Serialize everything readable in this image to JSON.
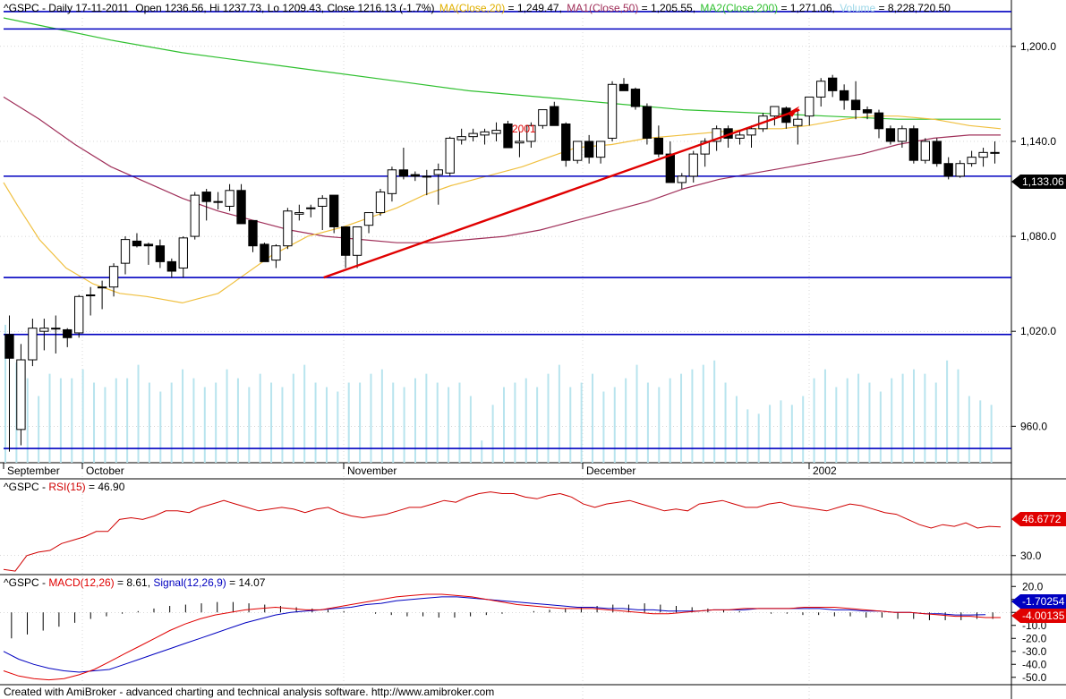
{
  "colors": {
    "background": "#ffffff",
    "up_candle": "#ffffff",
    "down_candle": "#000000",
    "ma20": "#f0c040",
    "ma50": "#a0305a",
    "ma200": "#30c030",
    "volume": "#b8e4ee",
    "hline": "#0000c0",
    "trend": "#e00000",
    "rsi": "#d00000",
    "macd": "#e00000",
    "signal": "#0000c0",
    "grid": "#b0b0b0"
  },
  "header": {
    "symbol": "^GSPC - Daily 17-11-2011",
    "ohlc": "Open 1236.56, Hi 1237.73, Lo 1209.43, Close 1216.13 (-1.7%)",
    "ma_label": "MA(Close,20)",
    "ma_value": " = 1,249.47,",
    "ma1_label": "MA1(Close,50)",
    "ma1_value": " = 1,205.55,",
    "ma2_label": "MA2(Close,200)",
    "ma2_value": " = 1,271.06,",
    "vol_label": "Volume",
    "vol_value": " = 8,228,720.50"
  },
  "price_axis": {
    "ticks": [
      "1,200.0",
      "1,140.0",
      "1,080.0",
      "1,020.0",
      "960.0"
    ],
    "last_value": "1,133.06"
  },
  "x_axis": {
    "labels": [
      "September",
      "October",
      "November",
      "December",
      "2002"
    ]
  },
  "annotations": {
    "year_label": "2001"
  },
  "rsi": {
    "label_sym": "^GSPC - ",
    "label_name": "RSI(15)",
    "label_value": " = 46.90",
    "ticks": [
      "30.0"
    ],
    "last_value": "46.6772"
  },
  "macd": {
    "label_sym": "^GSPC - ",
    "label_name": "MACD(12,26)",
    "label_value": " = 8.61, ",
    "signal_name": "Signal(12,26,9)",
    "signal_value": " = 14.07",
    "ticks": [
      "20.0",
      "10.0",
      "0.0",
      "-10.0",
      "-20.0",
      "-30.0",
      "-40.0",
      "-50.0"
    ],
    "last_macd": "-4.00135",
    "last_signal": "-1.70254"
  },
  "footer": {
    "text": "Created with AmiBroker - advanced charting and technical analysis software. http://www.amibroker.com"
  },
  "chart_data": {
    "type": "candlestick",
    "title": "^GSPC - Daily 17-11-2011",
    "price_range": [
      937,
      1218
    ],
    "candles": [
      [
        1018,
        1030,
        944,
        1003
      ],
      [
        958,
        1012,
        948,
        1002
      ],
      [
        1002,
        1028,
        998,
        1022
      ],
      [
        1020,
        1028,
        1008,
        1022
      ],
      [
        1022,
        1030,
        1006,
        1022
      ],
      [
        1021,
        1022,
        1010,
        1016
      ],
      [
        1019,
        1043,
        1016,
        1042
      ],
      [
        1043,
        1048,
        1030,
        1043
      ],
      [
        1048,
        1052,
        1034,
        1048
      ],
      [
        1048,
        1063,
        1042,
        1061
      ],
      [
        1063,
        1080,
        1056,
        1078
      ],
      [
        1077,
        1082,
        1073,
        1074
      ],
      [
        1075,
        1076,
        1062,
        1074
      ],
      [
        1074,
        1078,
        1060,
        1064
      ],
      [
        1064,
        1066,
        1054,
        1058
      ],
      [
        1060,
        1080,
        1054,
        1079
      ],
      [
        1080,
        1108,
        1078,
        1106
      ],
      [
        1108,
        1110,
        1090,
        1102
      ],
      [
        1102,
        1108,
        1097,
        1102
      ],
      [
        1099,
        1113,
        1096,
        1109
      ],
      [
        1109,
        1113,
        1092,
        1088
      ],
      [
        1090,
        1088,
        1070,
        1074
      ],
      [
        1075,
        1076,
        1064,
        1064
      ],
      [
        1065,
        1075,
        1060,
        1074
      ],
      [
        1074,
        1098,
        1072,
        1096
      ],
      [
        1094,
        1100,
        1090,
        1095
      ],
      [
        1098,
        1100,
        1092,
        1098
      ],
      [
        1099,
        1106,
        1084,
        1104
      ],
      [
        1106,
        1106,
        1082,
        1086
      ],
      [
        1086,
        1086,
        1060,
        1068
      ],
      [
        1068,
        1086,
        1060,
        1086
      ],
      [
        1087,
        1095,
        1082,
        1095
      ],
      [
        1095,
        1110,
        1093,
        1108
      ],
      [
        1107,
        1124,
        1102,
        1122
      ],
      [
        1122,
        1136,
        1116,
        1118
      ],
      [
        1119,
        1121,
        1115,
        1118
      ],
      [
        1118,
        1122,
        1106,
        1118
      ],
      [
        1119,
        1126,
        1100,
        1122
      ],
      [
        1120,
        1143,
        1118,
        1142
      ],
      [
        1141,
        1148,
        1138,
        1143
      ],
      [
        1143,
        1148,
        1140,
        1145
      ],
      [
        1144,
        1148,
        1138,
        1146
      ],
      [
        1145,
        1152,
        1140,
        1147
      ],
      [
        1151,
        1153,
        1140,
        1136
      ],
      [
        1139,
        1146,
        1130,
        1140
      ],
      [
        1140,
        1152,
        1136,
        1150
      ],
      [
        1150,
        1158,
        1148,
        1160
      ],
      [
        1162,
        1165,
        1150,
        1150
      ],
      [
        1151,
        1152,
        1124,
        1128
      ],
      [
        1128,
        1140,
        1126,
        1140
      ],
      [
        1140,
        1144,
        1126,
        1130
      ],
      [
        1130,
        1140,
        1126,
        1140
      ],
      [
        1142,
        1178,
        1140,
        1176
      ],
      [
        1176,
        1180,
        1172,
        1172
      ],
      [
        1173,
        1174,
        1160,
        1162
      ],
      [
        1162,
        1164,
        1138,
        1142
      ],
      [
        1142,
        1150,
        1130,
        1132
      ],
      [
        1132,
        1140,
        1114,
        1114
      ],
      [
        1114,
        1120,
        1110,
        1118
      ],
      [
        1118,
        1134,
        1114,
        1132
      ],
      [
        1132,
        1142,
        1124,
        1140
      ],
      [
        1140,
        1150,
        1134,
        1148
      ],
      [
        1148,
        1150,
        1136,
        1142
      ],
      [
        1142,
        1146,
        1138,
        1144
      ],
      [
        1144,
        1150,
        1136,
        1148
      ],
      [
        1148,
        1158,
        1146,
        1156
      ],
      [
        1156,
        1162,
        1150,
        1162
      ],
      [
        1161,
        1162,
        1148,
        1152
      ],
      [
        1150,
        1160,
        1138,
        1154
      ],
      [
        1156,
        1168,
        1150,
        1168
      ],
      [
        1168,
        1180,
        1162,
        1178
      ],
      [
        1180,
        1182,
        1168,
        1172
      ],
      [
        1172,
        1176,
        1160,
        1166
      ],
      [
        1166,
        1178,
        1154,
        1160
      ],
      [
        1160,
        1162,
        1154,
        1158
      ],
      [
        1158,
        1160,
        1142,
        1148
      ],
      [
        1148,
        1150,
        1138,
        1140
      ],
      [
        1140,
        1150,
        1136,
        1148
      ],
      [
        1148,
        1150,
        1126,
        1128
      ],
      [
        1128,
        1142,
        1126,
        1140
      ],
      [
        1140,
        1142,
        1124,
        1126
      ],
      [
        1126,
        1130,
        1116,
        1118
      ],
      [
        1118,
        1128,
        1117,
        1126
      ],
      [
        1126,
        1134,
        1124,
        1130
      ],
      [
        1130,
        1136,
        1124,
        1133
      ],
      [
        1133,
        1140,
        1126,
        1133
      ]
    ],
    "ma20": [
      [
        0,
        1114
      ],
      [
        15,
        1100
      ],
      [
        40,
        1078
      ],
      [
        70,
        1060
      ],
      [
        100,
        1050
      ],
      [
        130,
        1044
      ],
      [
        160,
        1042
      ],
      [
        200,
        1038
      ],
      [
        240,
        1044
      ],
      [
        270,
        1056
      ],
      [
        300,
        1068
      ],
      [
        340,
        1080
      ],
      [
        380,
        1086
      ],
      [
        410,
        1092
      ],
      [
        440,
        1098
      ],
      [
        470,
        1106
      ],
      [
        500,
        1112
      ],
      [
        540,
        1118
      ],
      [
        580,
        1124
      ],
      [
        610,
        1130
      ],
      [
        640,
        1136
      ],
      [
        680,
        1138
      ],
      [
        720,
        1142
      ],
      [
        760,
        1144
      ],
      [
        800,
        1146
      ],
      [
        840,
        1148
      ],
      [
        870,
        1148
      ],
      [
        900,
        1150
      ],
      [
        940,
        1154
      ],
      [
        970,
        1156
      ],
      [
        1000,
        1156
      ],
      [
        1040,
        1154
      ],
      [
        1080,
        1150
      ],
      [
        1115,
        1148
      ]
    ],
    "ma50": [
      [
        0,
        1168
      ],
      [
        40,
        1154
      ],
      [
        80,
        1138
      ],
      [
        120,
        1124
      ],
      [
        160,
        1114
      ],
      [
        200,
        1104
      ],
      [
        240,
        1096
      ],
      [
        280,
        1090
      ],
      [
        320,
        1084
      ],
      [
        360,
        1080
      ],
      [
        400,
        1078
      ],
      [
        440,
        1076
      ],
      [
        480,
        1076
      ],
      [
        520,
        1078
      ],
      [
        560,
        1080
      ],
      [
        600,
        1084
      ],
      [
        640,
        1090
      ],
      [
        680,
        1096
      ],
      [
        720,
        1102
      ],
      [
        760,
        1110
      ],
      [
        800,
        1116
      ],
      [
        840,
        1120
      ],
      [
        880,
        1124
      ],
      [
        920,
        1128
      ],
      [
        960,
        1132
      ],
      [
        1000,
        1138
      ],
      [
        1040,
        1142
      ],
      [
        1080,
        1144
      ],
      [
        1115,
        1144
      ]
    ],
    "ma200": [
      [
        0,
        1218
      ],
      [
        60,
        1211
      ],
      [
        120,
        1204
      ],
      [
        200,
        1196
      ],
      [
        280,
        1190
      ],
      [
        360,
        1184
      ],
      [
        440,
        1178
      ],
      [
        520,
        1172
      ],
      [
        600,
        1168
      ],
      [
        680,
        1164
      ],
      [
        760,
        1160
      ],
      [
        840,
        1158
      ],
      [
        920,
        1156
      ],
      [
        1000,
        1154
      ],
      [
        1060,
        1154
      ],
      [
        1115,
        1154
      ]
    ],
    "hlines": [
      1211,
      1222,
      1118,
      1054,
      1018,
      946
    ],
    "trend_line": [
      [
        358,
        1054
      ],
      [
        890,
        1160
      ]
    ],
    "volume": [
      0.62,
      0.45,
      0.38,
      0.3,
      0.4,
      0.38,
      0.38,
      0.42,
      0.36,
      0.34,
      0.38,
      0.38,
      0.44,
      0.36,
      0.32,
      0.36,
      0.42,
      0.38,
      0.34,
      0.36,
      0.42,
      0.38,
      0.34,
      0.4,
      0.36,
      0.34,
      0.4,
      0.44,
      0.36,
      0.34,
      0.32,
      0.36,
      0.36,
      0.4,
      0.42,
      0.36,
      0.34,
      0.38,
      0.4,
      0.36,
      0.34,
      0.36,
      0.3,
      0.1,
      0.26,
      0.34,
      0.36,
      0.38,
      0.34,
      0.4,
      0.44,
      0.34,
      0.36,
      0.4,
      0.32,
      0.34,
      0.38,
      0.44,
      0.36,
      0.34,
      0.38,
      0.4,
      0.42,
      0.44,
      0.46,
      0.36,
      0.3,
      0.24,
      0.22,
      0.26,
      0.28,
      0.26,
      0.3,
      0.38,
      0.42,
      0.34,
      0.38,
      0.4,
      0.36,
      0.32,
      0.38,
      0.4,
      0.42,
      0.4,
      0.36,
      0.46,
      0.42,
      0.3,
      0.28,
      0.26
    ],
    "rsi_range": [
      20,
      72
    ],
    "rsi": [
      22,
      21,
      30,
      32,
      33,
      37,
      39,
      41,
      44,
      44,
      51,
      52,
      51,
      53,
      56,
      56,
      55,
      58,
      60,
      62,
      60,
      58,
      56,
      57,
      58,
      57,
      55,
      57,
      58,
      55,
      53,
      52,
      53,
      54,
      56,
      58,
      58,
      60,
      62,
      61,
      64,
      66,
      67,
      66,
      66,
      64,
      63,
      65,
      66,
      64,
      60,
      58,
      60,
      61,
      62,
      60,
      58,
      56,
      57,
      56,
      60,
      61,
      62,
      60,
      58,
      58,
      60,
      61,
      59,
      58,
      57,
      56,
      58,
      60,
      59,
      57,
      55,
      54,
      51,
      48,
      46,
      48,
      47,
      49,
      46,
      47,
      46.7
    ],
    "macd_range": [
      -55,
      25
    ],
    "macd": [
      -45,
      -49,
      -51,
      -52,
      -51,
      -48,
      -44,
      -38,
      -32,
      -26,
      -20,
      -14,
      -9,
      -5,
      -2,
      0,
      2,
      3,
      4,
      3,
      2,
      2,
      4,
      6,
      8,
      10,
      12,
      13,
      14,
      14,
      13,
      12,
      10,
      8,
      6,
      5,
      4,
      3,
      3,
      3,
      2,
      1,
      0,
      -1,
      -1,
      0,
      1,
      2,
      2,
      3,
      3,
      3,
      3,
      4,
      4,
      4,
      3,
      2,
      1,
      0,
      0,
      -1,
      -2,
      -3,
      -3,
      -4,
      -4
    ],
    "signal": [
      -30,
      -36,
      -40,
      -43,
      -45,
      -46,
      -45,
      -44,
      -40,
      -36,
      -32,
      -28,
      -24,
      -20,
      -16,
      -12,
      -8,
      -5,
      -2,
      0,
      1,
      2,
      3,
      4,
      6,
      7,
      9,
      10,
      11,
      12,
      12,
      11,
      10,
      9,
      8,
      7,
      6,
      5,
      4,
      4,
      3,
      3,
      2,
      2,
      1,
      1,
      1,
      2,
      2,
      2,
      3,
      3,
      3,
      3,
      3,
      2,
      2,
      1,
      1,
      0,
      0,
      -1,
      -1,
      -2,
      -2,
      -1.7
    ],
    "histogram": [
      -20,
      -17,
      -14,
      -11,
      -8,
      -5,
      -3,
      -1,
      1,
      3,
      5,
      6,
      7,
      8,
      8,
      7,
      6,
      5,
      4,
      3,
      2,
      1,
      0,
      -1,
      -2,
      -3,
      -3,
      -4,
      -4,
      -3,
      -2,
      -1,
      0,
      1,
      2,
      3,
      4,
      5,
      6,
      6,
      7,
      6,
      5,
      4,
      3,
      2,
      1,
      0,
      -1,
      -1,
      -2,
      -2,
      -3,
      -3,
      -4,
      -4,
      -5,
      -5,
      -6,
      -6,
      -6,
      -5,
      -5
    ]
  }
}
